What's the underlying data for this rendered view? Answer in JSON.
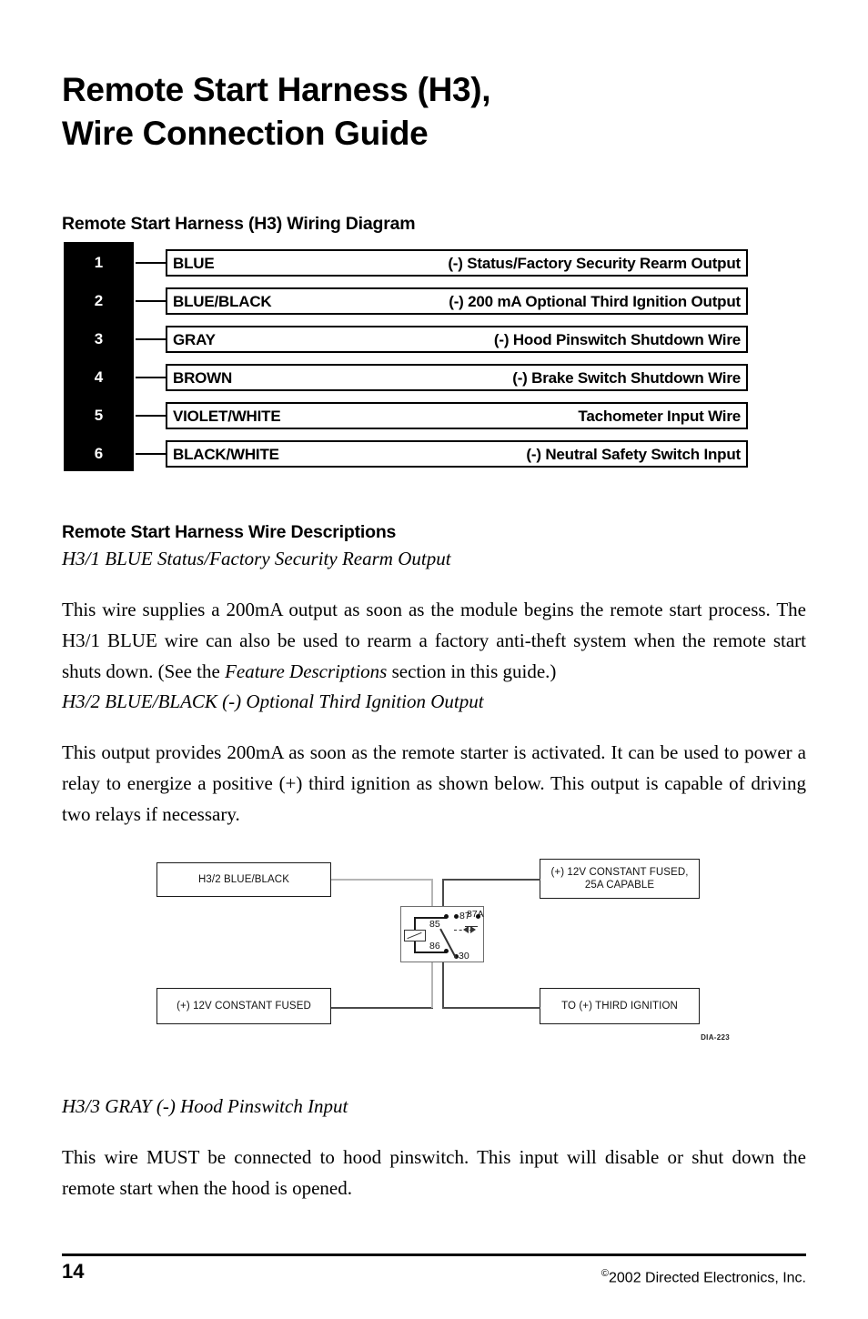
{
  "document": {
    "title_lines": [
      "Remote Start Harness (H3),",
      "Wire Connection Guide"
    ]
  },
  "headings": {
    "wiring_diagram": "Remote Start Harness (H3) Wiring Diagram",
    "wire_descriptions": "Remote Start Harness Wire Descriptions"
  },
  "harness_table": {
    "rows": [
      {
        "pin": "1",
        "wire": "BLUE",
        "description": "(-) Status/Factory Security Rearm Output"
      },
      {
        "pin": "2",
        "wire": "BLUE/BLACK",
        "description": "(-) 200 mA Optional Third Ignition Output"
      },
      {
        "pin": "3",
        "wire": "GRAY",
        "description": "(-) Hood Pinswitch Shutdown Wire"
      },
      {
        "pin": "4",
        "wire": "BROWN",
        "description": "(-) Brake Switch Shutdown Wire"
      },
      {
        "pin": "5",
        "wire": "VIOLET/WHITE",
        "description": "Tachometer Input Wire"
      },
      {
        "pin": "6",
        "wire": "BLACK/WHITE",
        "description": "(-) Neutral Safety Switch Input"
      }
    ]
  },
  "descriptions": {
    "h3_1": {
      "heading": "H3/1 BLUE Status/Factory Security Rearm Output",
      "body_before": "This wire supplies a 200mA output as soon as the module begins the remote start process. The H3/1 BLUE wire can also be used to rearm a factory anti-theft system when the remote start shuts down. (See the ",
      "body_italic": "Feature Descriptions",
      "body_after": " section in this guide.)"
    },
    "h3_2": {
      "heading": "H3/2 BLUE/BLACK (-) Optional Third Ignition Output",
      "body": "This output provides 200mA as soon as the remote starter is activated. It can be used to power a relay to energize a positive (+) third ignition as shown below. This output is capable of driving two relays if necessary."
    },
    "h3_3": {
      "heading": "H3/3 GRAY (-) Hood Pinswitch Input",
      "body": "This wire MUST be connected to hood pinswitch. This input will disable or shut down the remote start when the hood is opened."
    }
  },
  "relay_diagram": {
    "boxes": {
      "source_signal": "H3/2 BLUE/BLACK",
      "power_25a_line1": "(+) 12V CONSTANT FUSED,",
      "power_25a_line2": "25A CAPABLE",
      "power_constant": "(+) 12V CONSTANT FUSED",
      "output": "TO (+) THIRD IGNITION"
    },
    "relay_pins": {
      "pin_85": "85",
      "pin_86": "86",
      "pin_87": "87",
      "pin_87a": "87A",
      "pin_30": "30"
    },
    "figure_code": "DIA-223"
  },
  "footer": {
    "page_number": "14",
    "copyright_symbol": "©",
    "copyright_text": "2002 Directed Electronics, Inc."
  }
}
